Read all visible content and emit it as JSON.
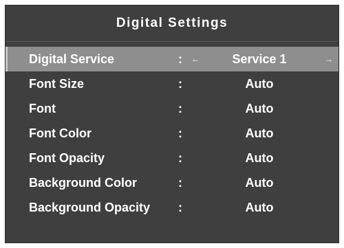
{
  "menu": {
    "title": "Digital Settings",
    "separator": ":",
    "arrow_left": "←",
    "arrow_right": "→",
    "items": [
      {
        "label": "Digital Service",
        "value": "Service 1",
        "selected": true
      },
      {
        "label": "Font Size",
        "value": "Auto"
      },
      {
        "label": "Font",
        "value": "Auto"
      },
      {
        "label": "Font Color",
        "value": "Auto"
      },
      {
        "label": "Font Opacity",
        "value": "Auto"
      },
      {
        "label": "Background Color",
        "value": "Auto"
      },
      {
        "label": "Background Opacity",
        "value": "Auto"
      }
    ]
  },
  "colors": {
    "panel_background": "#3f3f3f",
    "selected_row": "#8e8e8e",
    "text": "#ffffff"
  }
}
